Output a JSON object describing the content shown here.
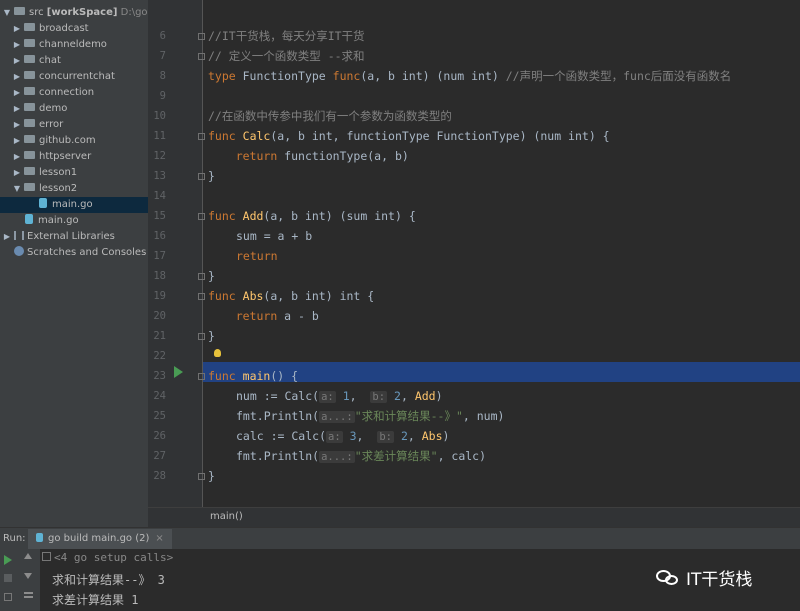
{
  "project": {
    "root_label": "src",
    "root_module": "[workSpace]",
    "root_path": "D:\\goland",
    "folders": [
      "broadcast",
      "channeldemo",
      "chat",
      "concurrentchat",
      "connection",
      "demo",
      "error",
      "github.com",
      "httpserver",
      "lesson1",
      "lesson2"
    ],
    "lesson2_child": "main.go",
    "root_file": "main.go",
    "external_libraries": "External Libraries",
    "scratches": "Scratches and Consoles"
  },
  "editor": {
    "line_numbers": [
      "6",
      "7",
      "8",
      "9",
      "10",
      "11",
      "12",
      "13",
      "14",
      "15",
      "16",
      "17",
      "18",
      "19",
      "20",
      "21",
      "22",
      "23",
      "24",
      "25",
      "26",
      "27",
      "28"
    ],
    "l6": "//IT干货栈，每天分享IT干货",
    "l7": "// 定义一个函数类型 --求和",
    "l8_kw": "type",
    "l8_name": " FunctionType ",
    "l8_func": "func",
    "l8_params": "(a, b int) (num int)",
    "l8_comment": " //声明一个函数类型，func后面没有函数名",
    "l10": "//在函数中传参中我们有一个参数为函数类型的",
    "l11_kw": "func",
    "l11_name": "Calc",
    "l11_rest": "(a, b int, functionType FunctionType) (num int) {",
    "l12_kw": "return",
    "l12_rest": " functionType(a, b)",
    "l13": "}",
    "l15_kw": "func",
    "l15_name": "Add",
    "l15_rest": "(a, b int) (sum int) {",
    "l16": "sum = a + b",
    "l17_kw": "return",
    "l18": "}",
    "l19_kw": "func",
    "l19_name": "Abs",
    "l19_rest": "(a, b int) int {",
    "l20_kw": "return",
    "l20_rest": " a - b",
    "l21": "}",
    "l23_kw": "func",
    "l23_name": "main",
    "l23_rest": "() {",
    "l24_pre": "num := Calc(",
    "l24_hint_a": "a:",
    "l24_num_a": "1",
    "l24_comma1": ",",
    "l24_hint_b": "b:",
    "l24_num_b": "2",
    "l24_post": ", ",
    "l24_fn": "Add",
    "l24_close": ")",
    "l25_pre": "fmt.Println(",
    "l25_hint": "a...:",
    "l25_str": "\"求和计算结果--》\"",
    "l25_post": ", num)",
    "l26_pre": "calc := Calc(",
    "l26_hint_a": "a:",
    "l26_num_a": "3",
    "l26_comma1": ",",
    "l26_hint_b": "b:",
    "l26_num_b": "2",
    "l26_post": ", ",
    "l26_fn": "Abs",
    "l26_close": ")",
    "l27_pre": "fmt.Println(",
    "l27_hint": "a...:",
    "l27_str": "\"求差计算结果\"",
    "l27_post": ", calc)",
    "l28": "}"
  },
  "breadcrumb": "main()",
  "run": {
    "label": "Run:",
    "tab": "go build main.go (2)",
    "setup_calls": "<4 go setup calls>",
    "output1": "求和计算结果--》 3",
    "output2": "求差计算结果 1"
  },
  "watermark": "IT干货栈",
  "colors": {
    "keyword": "#cc7832",
    "function": "#ffc66d",
    "comment": "#808080",
    "string": "#6a8759",
    "number": "#6897bb",
    "highlight": "#214283"
  }
}
